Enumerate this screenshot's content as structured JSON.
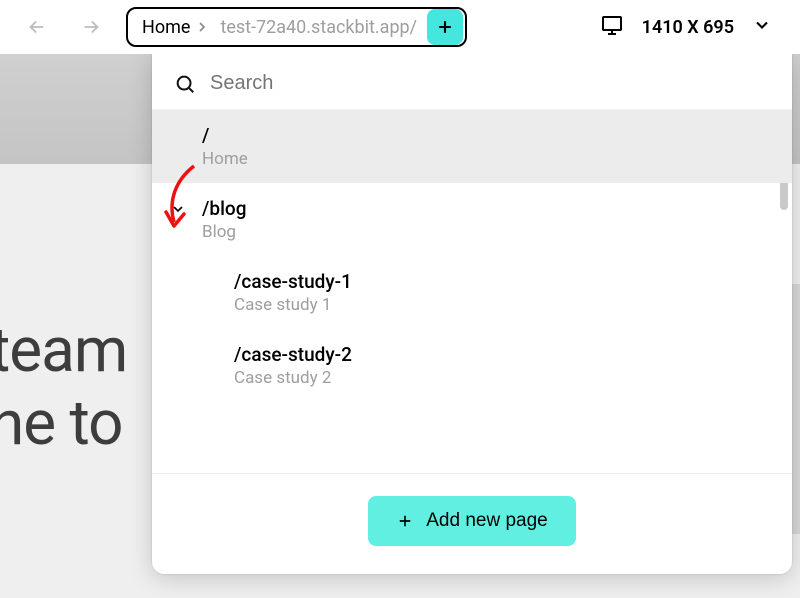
{
  "nav": {
    "back_disabled": true,
    "forward_disabled": true
  },
  "breadcrumb": {
    "home_label": "Home",
    "url": "test-72a40.stackbit.app/"
  },
  "viewport": {
    "dims": "1410 X 695"
  },
  "panel": {
    "search_placeholder": "Search",
    "add_page_label": "Add new page",
    "pages": [
      {
        "path": "/",
        "title": "Home",
        "selected": true,
        "depth": 0,
        "expandable": false
      },
      {
        "path": "/blog",
        "title": "Blog",
        "selected": false,
        "depth": 0,
        "expandable": true
      },
      {
        "path": "/case-study-1",
        "title": "Case study 1",
        "selected": false,
        "depth": 1,
        "expandable": false
      },
      {
        "path": "/case-study-2",
        "title": "Case study 2",
        "selected": false,
        "depth": 1,
        "expandable": false
      }
    ]
  },
  "hero": {
    "line1": " team",
    "line2": "ne to "
  }
}
